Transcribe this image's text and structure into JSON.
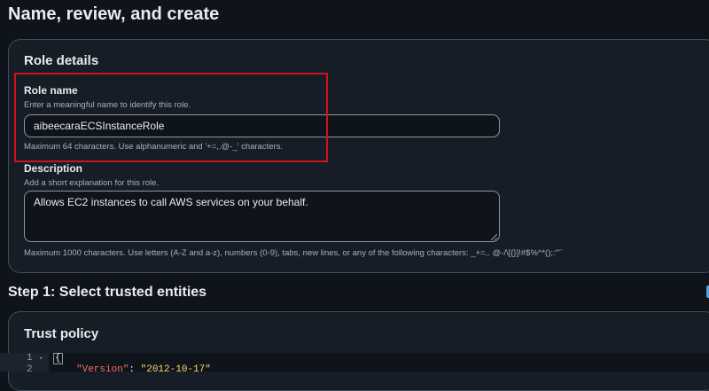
{
  "page": {
    "title": "Name, review, and create"
  },
  "role_details": {
    "title": "Role details",
    "role_name": {
      "label": "Role name",
      "description": "Enter a meaningful name to identify this role.",
      "value": "aibeecaraECSInstanceRole",
      "constraint": "Maximum 64 characters. Use alphanumeric and '+=,.@-_' characters."
    },
    "description": {
      "label": "Description",
      "hint": "Add a short explanation for this role.",
      "value": "Allows EC2 instances to call AWS services on your behalf.",
      "constraint": "Maximum 1000 characters. Use letters (A-Z and a-z), numbers (0-9), tabs, new lines, or any of the following characters: _+=,. @-/\\[{}]!#$%^*();:\"'`"
    },
    "highlight_color": "#d0121b"
  },
  "step1": {
    "heading": "Step 1: Select trusted entities"
  },
  "trust_policy": {
    "title": "Trust policy",
    "editor_lines": [
      {
        "number": "1",
        "fold": "▾",
        "text": "{"
      },
      {
        "number": "2",
        "fold": "",
        "key": "\"Version\"",
        "sep": ": ",
        "value": "\"2012-10-17\""
      }
    ]
  },
  "colors": {
    "background": "#0f141a",
    "panel": "#161d26",
    "accent": "#539fe5"
  }
}
